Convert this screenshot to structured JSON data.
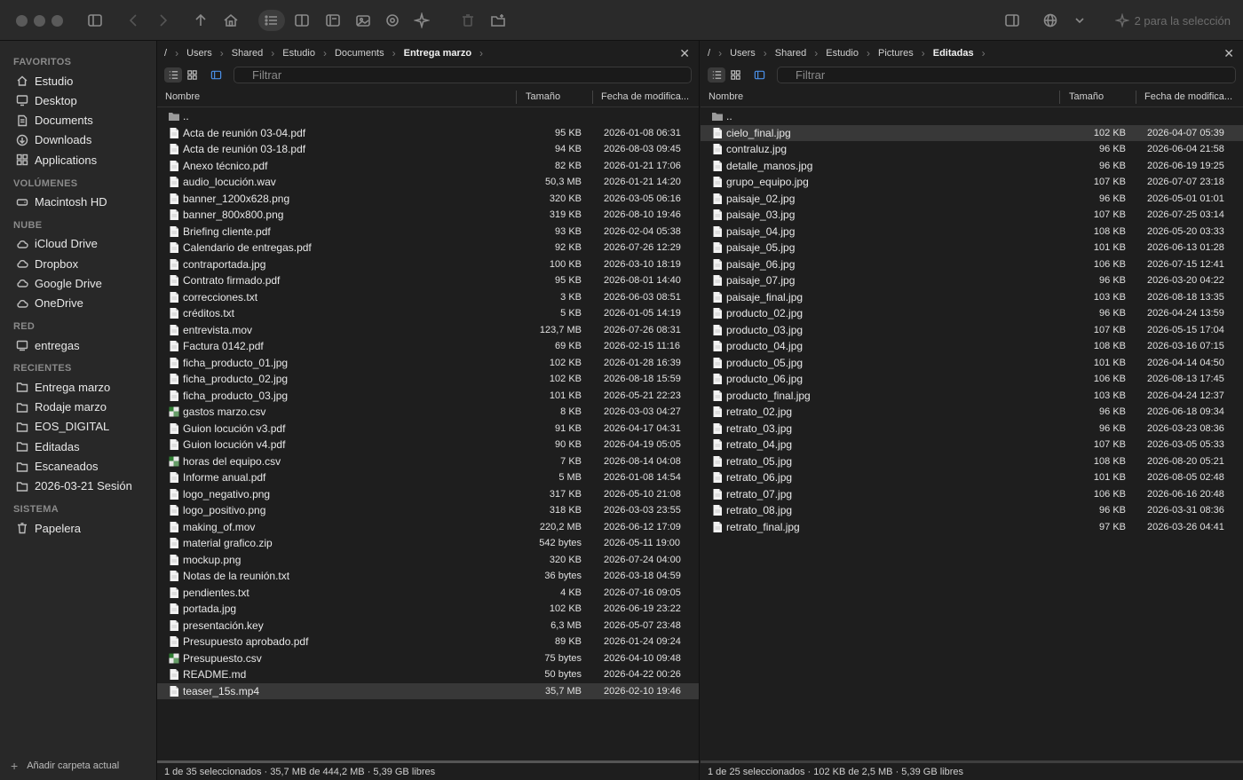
{
  "toolbar": {
    "selection_action": "2 para la selección"
  },
  "sidebar": {
    "sections": [
      {
        "title": "FAVORITOS",
        "items": [
          {
            "label": "Estudio",
            "icon": "home-icon"
          },
          {
            "label": "Desktop",
            "icon": "desktop-icon"
          },
          {
            "label": "Documents",
            "icon": "document-icon"
          },
          {
            "label": "Downloads",
            "icon": "download-icon"
          },
          {
            "label": "Applications",
            "icon": "apps-icon"
          }
        ]
      },
      {
        "title": "VOLÚMENES",
        "items": [
          {
            "label": "Macintosh HD",
            "icon": "drive-icon"
          }
        ]
      },
      {
        "title": "NUBE",
        "items": [
          {
            "label": "iCloud Drive",
            "icon": "cloud-icon"
          },
          {
            "label": "Dropbox",
            "icon": "cloud-icon"
          },
          {
            "label": "Google Drive",
            "icon": "cloud-icon"
          },
          {
            "label": "OneDrive",
            "icon": "cloud-icon"
          }
        ]
      },
      {
        "title": "RED",
        "items": [
          {
            "label": "entregas",
            "icon": "network-drive-icon"
          }
        ]
      },
      {
        "title": "RECIENTES",
        "items": [
          {
            "label": "Entrega marzo",
            "icon": "folder-icon"
          },
          {
            "label": "Rodaje marzo",
            "icon": "folder-icon"
          },
          {
            "label": "EOS_DIGITAL",
            "icon": "folder-icon"
          },
          {
            "label": "Editadas",
            "icon": "folder-icon"
          },
          {
            "label": "Escaneados",
            "icon": "folder-icon"
          },
          {
            "label": "2026-03-21 Sesión",
            "icon": "folder-icon"
          }
        ]
      },
      {
        "title": "SISTEMA",
        "items": [
          {
            "label": "Papelera",
            "icon": "trash-icon"
          }
        ]
      }
    ],
    "add_label": "Añadir carpeta actual"
  },
  "left_pane": {
    "breadcrumb": [
      "/",
      "Users",
      "Shared",
      "Estudio",
      "Documents",
      "Entrega marzo"
    ],
    "filter_placeholder": "Filtrar",
    "columns": {
      "name": "Nombre",
      "size": "Tamaño",
      "date": "Fecha de modifica..."
    },
    "files": [
      {
        "name": "..",
        "size": "",
        "date": "",
        "type": "folder"
      },
      {
        "name": "Acta de reunión 03-04.pdf",
        "size": "95 KB",
        "date": "2026-01-08 06:31",
        "type": "doc"
      },
      {
        "name": "Acta de reunión 03-18.pdf",
        "size": "94 KB",
        "date": "2026-08-03 09:45",
        "type": "doc"
      },
      {
        "name": "Anexo técnico.pdf",
        "size": "82 KB",
        "date": "2026-01-21 17:06",
        "type": "doc"
      },
      {
        "name": "audio_locución.wav",
        "size": "50,3 MB",
        "date": "2026-01-21 14:20",
        "type": "doc"
      },
      {
        "name": "banner_1200x628.png",
        "size": "320 KB",
        "date": "2026-03-05 06:16",
        "type": "doc"
      },
      {
        "name": "banner_800x800.png",
        "size": "319 KB",
        "date": "2026-08-10 19:46",
        "type": "doc"
      },
      {
        "name": "Briefing cliente.pdf",
        "size": "93 KB",
        "date": "2026-02-04 05:38",
        "type": "doc"
      },
      {
        "name": "Calendario de entregas.pdf",
        "size": "92 KB",
        "date": "2026-07-26 12:29",
        "type": "doc"
      },
      {
        "name": "contraportada.jpg",
        "size": "100 KB",
        "date": "2026-03-10 18:19",
        "type": "doc"
      },
      {
        "name": "Contrato firmado.pdf",
        "size": "95 KB",
        "date": "2026-08-01 14:40",
        "type": "doc"
      },
      {
        "name": "correcciones.txt",
        "size": "3 KB",
        "date": "2026-06-03 08:51",
        "type": "doc"
      },
      {
        "name": "créditos.txt",
        "size": "5 KB",
        "date": "2026-01-05 14:19",
        "type": "doc"
      },
      {
        "name": "entrevista.mov",
        "size": "123,7 MB",
        "date": "2026-07-26 08:31",
        "type": "doc"
      },
      {
        "name": "Factura 0142.pdf",
        "size": "69 KB",
        "date": "2026-02-15 11:16",
        "type": "doc"
      },
      {
        "name": "ficha_producto_01.jpg",
        "size": "102 KB",
        "date": "2026-01-28 16:39",
        "type": "doc"
      },
      {
        "name": "ficha_producto_02.jpg",
        "size": "102 KB",
        "date": "2026-08-18 15:59",
        "type": "doc"
      },
      {
        "name": "ficha_producto_03.jpg",
        "size": "101 KB",
        "date": "2026-05-21 22:23",
        "type": "doc"
      },
      {
        "name": "gastos marzo.csv",
        "size": "8 KB",
        "date": "2026-03-03 04:27",
        "type": "csv"
      },
      {
        "name": "Guion locución v3.pdf",
        "size": "91 KB",
        "date": "2026-04-17 04:31",
        "type": "doc"
      },
      {
        "name": "Guion locución v4.pdf",
        "size": "90 KB",
        "date": "2026-04-19 05:05",
        "type": "doc"
      },
      {
        "name": "horas del equipo.csv",
        "size": "7 KB",
        "date": "2026-08-14 04:08",
        "type": "csv"
      },
      {
        "name": "Informe anual.pdf",
        "size": "5 MB",
        "date": "2026-01-08 14:54",
        "type": "doc"
      },
      {
        "name": "logo_negativo.png",
        "size": "317 KB",
        "date": "2026-05-10 21:08",
        "type": "doc"
      },
      {
        "name": "logo_positivo.png",
        "size": "318 KB",
        "date": "2026-03-03 23:55",
        "type": "doc"
      },
      {
        "name": "making_of.mov",
        "size": "220,2 MB",
        "date": "2026-06-12 17:09",
        "type": "doc"
      },
      {
        "name": "material grafico.zip",
        "size": "542 bytes",
        "date": "2026-05-11 19:00",
        "type": "doc"
      },
      {
        "name": "mockup.png",
        "size": "320 KB",
        "date": "2026-07-24 04:00",
        "type": "doc"
      },
      {
        "name": "Notas de la reunión.txt",
        "size": "36 bytes",
        "date": "2026-03-18 04:59",
        "type": "doc"
      },
      {
        "name": "pendientes.txt",
        "size": "4 KB",
        "date": "2026-07-16 09:05",
        "type": "doc"
      },
      {
        "name": "portada.jpg",
        "size": "102 KB",
        "date": "2026-06-19 23:22",
        "type": "doc"
      },
      {
        "name": "presentación.key",
        "size": "6,3 MB",
        "date": "2026-05-07 23:48",
        "type": "doc"
      },
      {
        "name": "Presupuesto aprobado.pdf",
        "size": "89 KB",
        "date": "2026-01-24 09:24",
        "type": "doc"
      },
      {
        "name": "Presupuesto.csv",
        "size": "75 bytes",
        "date": "2026-04-10 09:48",
        "type": "csv"
      },
      {
        "name": "README.md",
        "size": "50 bytes",
        "date": "2026-04-22 00:26",
        "type": "doc"
      },
      {
        "name": "teaser_15s.mp4",
        "size": "35,7 MB",
        "date": "2026-02-10 19:46",
        "type": "doc",
        "selected": true
      }
    ],
    "status": "1 de 35 seleccionados · 35,7 MB de 444,2 MB · 5,39 GB libres"
  },
  "right_pane": {
    "breadcrumb": [
      "/",
      "Users",
      "Shared",
      "Estudio",
      "Pictures",
      "Editadas"
    ],
    "filter_placeholder": "Filtrar",
    "columns": {
      "name": "Nombre",
      "size": "Tamaño",
      "date": "Fecha de modifica..."
    },
    "files": [
      {
        "name": "..",
        "size": "",
        "date": "",
        "type": "folder"
      },
      {
        "name": "cielo_final.jpg",
        "size": "102 KB",
        "date": "2026-04-07 05:39",
        "type": "doc",
        "selected": true
      },
      {
        "name": "contraluz.jpg",
        "size": "96 KB",
        "date": "2026-06-04 21:58",
        "type": "doc"
      },
      {
        "name": "detalle_manos.jpg",
        "size": "96 KB",
        "date": "2026-06-19 19:25",
        "type": "doc"
      },
      {
        "name": "grupo_equipo.jpg",
        "size": "107 KB",
        "date": "2026-07-07 23:18",
        "type": "doc"
      },
      {
        "name": "paisaje_02.jpg",
        "size": "96 KB",
        "date": "2026-05-01 01:01",
        "type": "doc"
      },
      {
        "name": "paisaje_03.jpg",
        "size": "107 KB",
        "date": "2026-07-25 03:14",
        "type": "doc"
      },
      {
        "name": "paisaje_04.jpg",
        "size": "108 KB",
        "date": "2026-05-20 03:33",
        "type": "doc"
      },
      {
        "name": "paisaje_05.jpg",
        "size": "101 KB",
        "date": "2026-06-13 01:28",
        "type": "doc"
      },
      {
        "name": "paisaje_06.jpg",
        "size": "106 KB",
        "date": "2026-07-15 12:41",
        "type": "doc"
      },
      {
        "name": "paisaje_07.jpg",
        "size": "96 KB",
        "date": "2026-03-20 04:22",
        "type": "doc"
      },
      {
        "name": "paisaje_final.jpg",
        "size": "103 KB",
        "date": "2026-08-18 13:35",
        "type": "doc"
      },
      {
        "name": "producto_02.jpg",
        "size": "96 KB",
        "date": "2026-04-24 13:59",
        "type": "doc"
      },
      {
        "name": "producto_03.jpg",
        "size": "107 KB",
        "date": "2026-05-15 17:04",
        "type": "doc"
      },
      {
        "name": "producto_04.jpg",
        "size": "108 KB",
        "date": "2026-03-16 07:15",
        "type": "doc"
      },
      {
        "name": "producto_05.jpg",
        "size": "101 KB",
        "date": "2026-04-14 04:50",
        "type": "doc"
      },
      {
        "name": "producto_06.jpg",
        "size": "106 KB",
        "date": "2026-08-13 17:45",
        "type": "doc"
      },
      {
        "name": "producto_final.jpg",
        "size": "103 KB",
        "date": "2026-04-24 12:37",
        "type": "doc"
      },
      {
        "name": "retrato_02.jpg",
        "size": "96 KB",
        "date": "2026-06-18 09:34",
        "type": "doc"
      },
      {
        "name": "retrato_03.jpg",
        "size": "96 KB",
        "date": "2026-03-23 08:36",
        "type": "doc"
      },
      {
        "name": "retrato_04.jpg",
        "size": "107 KB",
        "date": "2026-03-05 05:33",
        "type": "doc"
      },
      {
        "name": "retrato_05.jpg",
        "size": "108 KB",
        "date": "2026-08-20 05:21",
        "type": "doc"
      },
      {
        "name": "retrato_06.jpg",
        "size": "101 KB",
        "date": "2026-08-05 02:48",
        "type": "doc"
      },
      {
        "name": "retrato_07.jpg",
        "size": "106 KB",
        "date": "2026-06-16 20:48",
        "type": "doc"
      },
      {
        "name": "retrato_08.jpg",
        "size": "96 KB",
        "date": "2026-03-31 08:36",
        "type": "doc"
      },
      {
        "name": "retrato_final.jpg",
        "size": "97 KB",
        "date": "2026-03-26 04:41",
        "type": "doc"
      }
    ],
    "status": "1 de 25 seleccionados · 102 KB de 2,5 MB · 5,39 GB libres"
  },
  "colors": {
    "accent": "#4a8fe7",
    "selection": "#383838",
    "csv_green": "#2f7d32"
  }
}
